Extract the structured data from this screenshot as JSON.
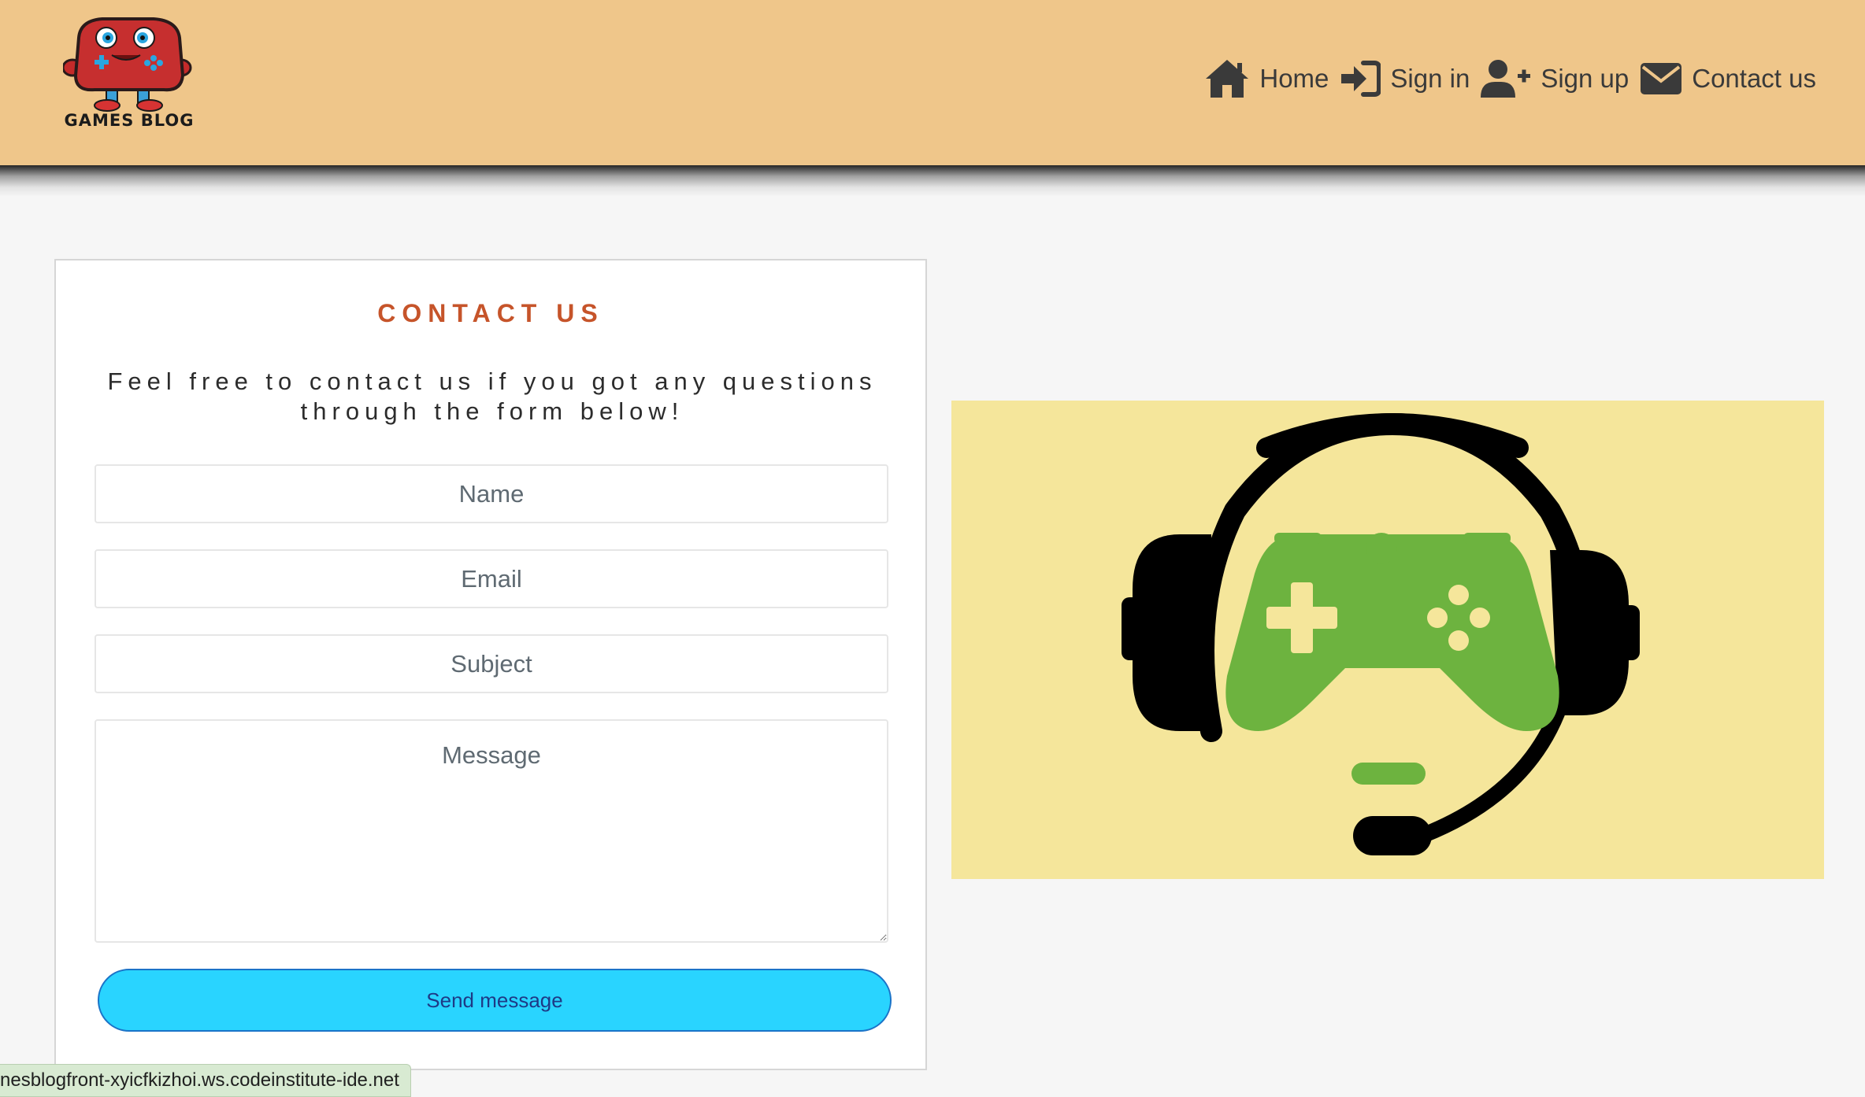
{
  "brand": {
    "name": "GAMES BLOG",
    "logo_icon": "red-controller-mascot-icon"
  },
  "nav": {
    "items": [
      {
        "label": "Home",
        "icon": "home-icon"
      },
      {
        "label": "Sign in",
        "icon": "sign-in-icon"
      },
      {
        "label": "Sign up",
        "icon": "user-plus-icon"
      },
      {
        "label": "Contact us",
        "icon": "envelope-icon"
      }
    ]
  },
  "contact": {
    "title": "CONTACT US",
    "intro": "Feel free to contact us if you got any questions through the form below!",
    "name_placeholder": "Name",
    "email_placeholder": "Email",
    "subject_placeholder": "Subject",
    "message_placeholder": "Message",
    "send_label": "Send message"
  },
  "hero": {
    "icon": "gaming-headset-controller-icon"
  },
  "status_bar": {
    "url": "nesblogfront-xyicfkizhoi.ws.codeinstitute-ide.net"
  },
  "colors": {
    "header_bg": "#efc68a",
    "page_bg": "#f6f6f6",
    "title_accent": "#c6542a",
    "button_bg": "#29d4ff",
    "button_border": "#1a73c8",
    "hero_bg": "#f5e69b",
    "controller_green": "#6db33f"
  }
}
